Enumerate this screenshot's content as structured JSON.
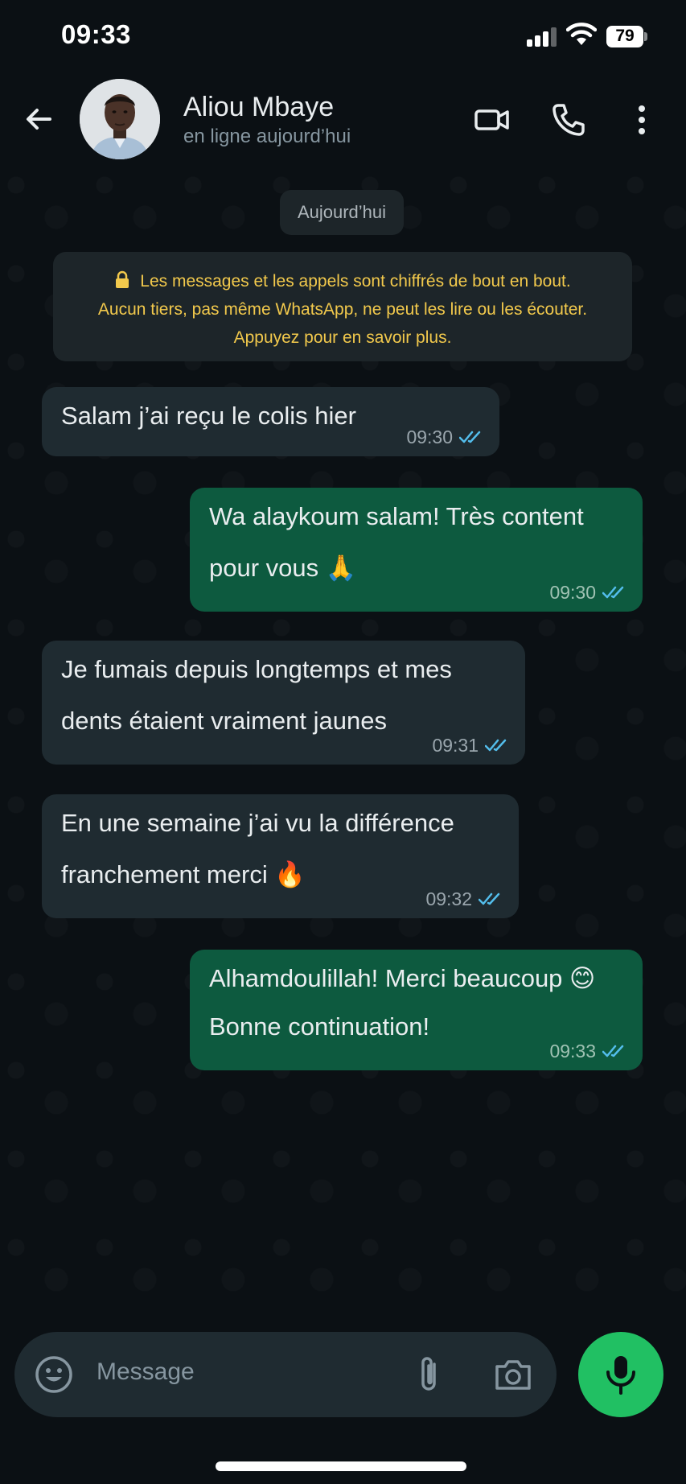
{
  "status_bar": {
    "time": "09:33",
    "battery": "79"
  },
  "header": {
    "contact_name": "Aliou Mbaye",
    "contact_status": "en ligne aujourd’hui",
    "icons": [
      "back-arrow-icon",
      "video-call-icon",
      "phone-icon",
      "more-vertical-icon"
    ]
  },
  "date_chip": "Aujourd’hui",
  "encryption_notice": {
    "line1": "Les messages et les appels sont chiffrés de bout en bout.",
    "line2": "Aucun tiers, pas même WhatsApp, ne peut les lire ou les écouter.",
    "line3": "Appuyez pour en savoir plus."
  },
  "messages": [
    {
      "direction": "incoming",
      "lines": [
        "Salam j’ai reçu le colis hier"
      ],
      "time": "09:30",
      "status": "read"
    },
    {
      "direction": "outgoing",
      "lines": [
        "Wa alaykoum salam! Très content",
        "pour vous 🙏"
      ],
      "time": "09:30",
      "status": "read"
    },
    {
      "direction": "incoming",
      "lines": [
        "Je fumais depuis longtemps et mes",
        "dents étaient vraiment jaunes"
      ],
      "time": "09:31",
      "status": "read"
    },
    {
      "direction": "incoming",
      "lines": [
        "En une semaine j’ai vu la différence",
        "franchement merci 🔥"
      ],
      "time": "09:32",
      "status": "read"
    },
    {
      "direction": "outgoing",
      "lines": [
        "Alhamdoulillah! Merci beaucoup 😊",
        "Bonne continuation!"
      ],
      "time": "09:33",
      "status": "read"
    }
  ],
  "composer": {
    "placeholder": "Message"
  },
  "colors": {
    "background": "#0b1014",
    "incoming_bubble": "#1f2b31",
    "outgoing_bubble": "#0d5a3f",
    "read_ticks": "#53bdeb",
    "mic_button": "#21c063",
    "notice_text": "#f2c94c"
  }
}
